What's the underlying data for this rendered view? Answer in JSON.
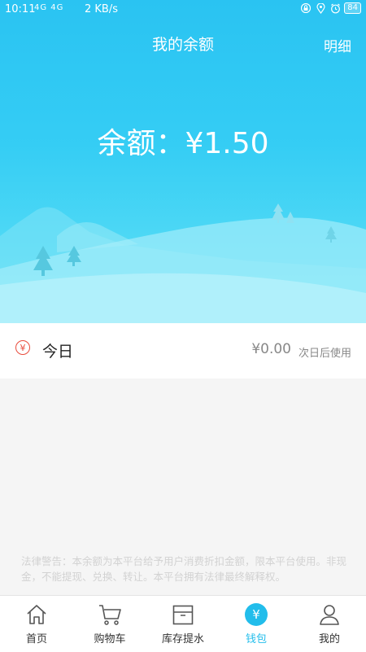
{
  "statusbar": {
    "time": "10:11",
    "network": "4G 4G",
    "speed": "2 KB/s",
    "battery": "84"
  },
  "header": {
    "title": "我的余额",
    "detail_link": "明细"
  },
  "balance": {
    "text": "余额：¥1.50"
  },
  "today": {
    "icon_symbol": "¥",
    "label": "今日",
    "amount": "¥0.00",
    "note": "次日后使用"
  },
  "legal_notice": "法律警告：本余额为本平台给予用户消费折扣金额，限本平台使用。非现金，不能提现、兑换、转让。本平台拥有法律最终解释权。",
  "tabbar": {
    "items": [
      {
        "label": "首页",
        "icon": "home-icon"
      },
      {
        "label": "购物车",
        "icon": "cart-icon"
      },
      {
        "label": "库存提水",
        "icon": "box-icon"
      },
      {
        "label": "钱包",
        "icon": "wallet-icon",
        "badge": "¥"
      },
      {
        "label": "我的",
        "icon": "user-icon"
      }
    ],
    "active_index": 3
  },
  "colors": {
    "accent": "#22bdeb",
    "yen_red": "#e84b3c",
    "hero_top": "#2ac3f2",
    "hero_bottom": "#63e2f6"
  }
}
